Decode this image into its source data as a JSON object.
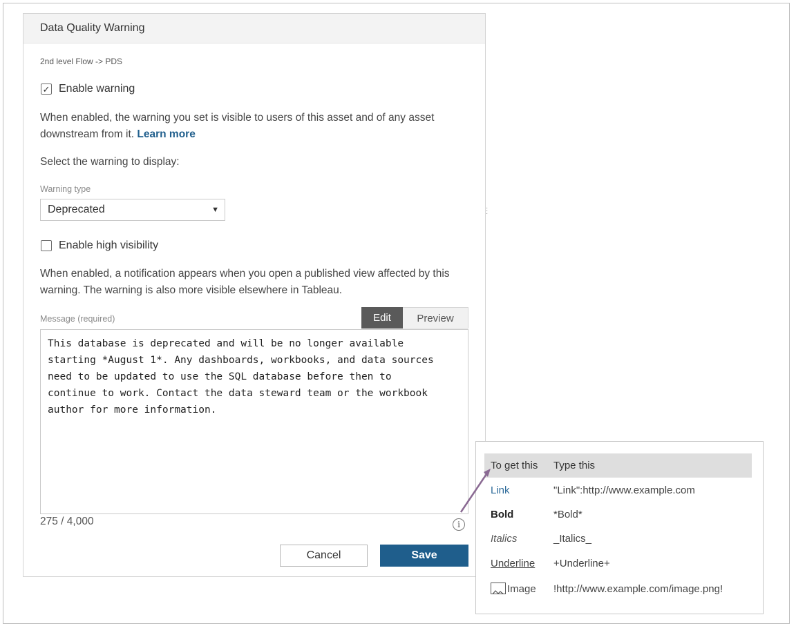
{
  "dialog": {
    "title": "Data Quality Warning",
    "breadcrumb": "2nd level Flow -> PDS",
    "enable_warning": {
      "label": "Enable warning",
      "checked": true,
      "check_glyph": "✓"
    },
    "description": "When enabled, the warning you set is visible to users of this asset and of any asset downstream from it.",
    "learn_more": "Learn more",
    "select_prompt": "Select the warning to display:",
    "warning_type": {
      "label": "Warning type",
      "value": "Deprecated",
      "caret_glyph": "▼"
    },
    "high_visibility": {
      "label": "Enable high visibility",
      "checked": false
    },
    "high_visibility_description": "When enabled, a notification appears when you open a published view affected by this warning. The warning is also more visible elsewhere in Tableau.",
    "message": {
      "label": "Message (required)",
      "tabs": [
        "Edit",
        "Preview"
      ],
      "active_tab": "Edit",
      "text": "This database is deprecated and will be no longer available\nstarting *August 1*. Any dashboards, workbooks, and data sources\nneed to be updated to use the SQL database before then to\ncontinue to work. Contact the data steward team or the workbook\nauthor for more information.",
      "count": "275 / 4,000"
    },
    "info_glyph": "i",
    "buttons": {
      "cancel": "Cancel",
      "save": "Save"
    }
  },
  "format_help": {
    "headers": [
      "To get this",
      "Type this"
    ],
    "rows": [
      {
        "get": "Link",
        "type": "\"Link\":http://www.example.com"
      },
      {
        "get": "Bold",
        "type": "*Bold*"
      },
      {
        "get": "Italics",
        "type": "_Italics_"
      },
      {
        "get": "Underline",
        "type": "+Underline+"
      },
      {
        "get": "Image",
        "type": "!http://www.example.com/image.png!",
        "icon": "image-icon"
      }
    ]
  },
  "colors": {
    "accent": "#1f5e8c",
    "header_bg": "#f3f3f3",
    "active_tab_bg": "#5a5a5a",
    "popup_header_bg": "#dedede",
    "arrow": "#8a6a93"
  }
}
